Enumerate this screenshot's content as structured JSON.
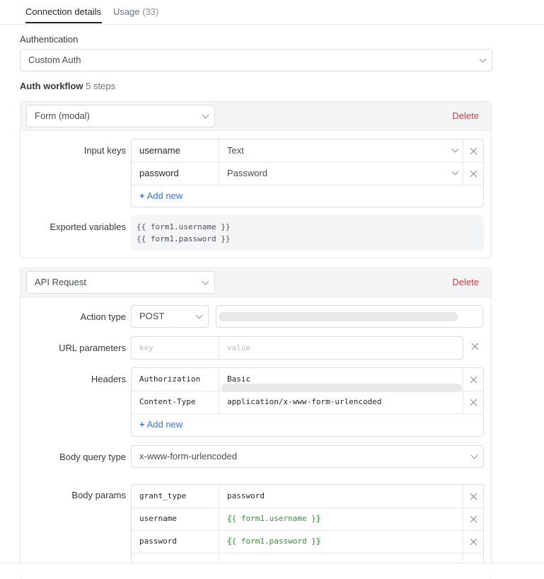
{
  "tabs": [
    {
      "label": "Connection details"
    },
    {
      "label": "Usage",
      "count": "(33)"
    }
  ],
  "authentication": {
    "label": "Authentication",
    "value": "Custom Auth"
  },
  "workflow": {
    "title": "Auth workflow",
    "steps": "5 steps"
  },
  "step1": {
    "type": "Form (modal)",
    "delete_label": "Delete",
    "input_keys_label": "Input keys",
    "input_keys": [
      {
        "key": "username",
        "type": "Text"
      },
      {
        "key": "password",
        "type": "Password"
      }
    ],
    "add_new": "Add new",
    "exported_label": "Exported variables",
    "exported": [
      "{{ form1.username }}",
      "{{ form1.password }}"
    ]
  },
  "step2": {
    "type": "API Request",
    "delete_label": "Delete",
    "action_type_label": "Action type",
    "method": "POST",
    "url_params_label": "URL parameters",
    "url_key_placeholder": "key",
    "url_value_placeholder": "value",
    "headers_label": "Headers",
    "headers": [
      {
        "key": "Authorization",
        "value": "Basic"
      },
      {
        "key": "Content-Type",
        "value": "application/x-www-form-urlencoded"
      }
    ],
    "add_new": "Add new",
    "body_query_type_label": "Body query type",
    "body_query_type": "x-www-form-urlencoded",
    "body_params_label": "Body params",
    "body_params": [
      {
        "key": "grant_type",
        "value": "password"
      },
      {
        "key": "username",
        "value": "form1.username"
      },
      {
        "key": "password",
        "value": "form1.password"
      }
    ]
  },
  "colors": {
    "accent": "#3a78d6",
    "danger": "#d9363e",
    "template": "#3e8a3e"
  }
}
